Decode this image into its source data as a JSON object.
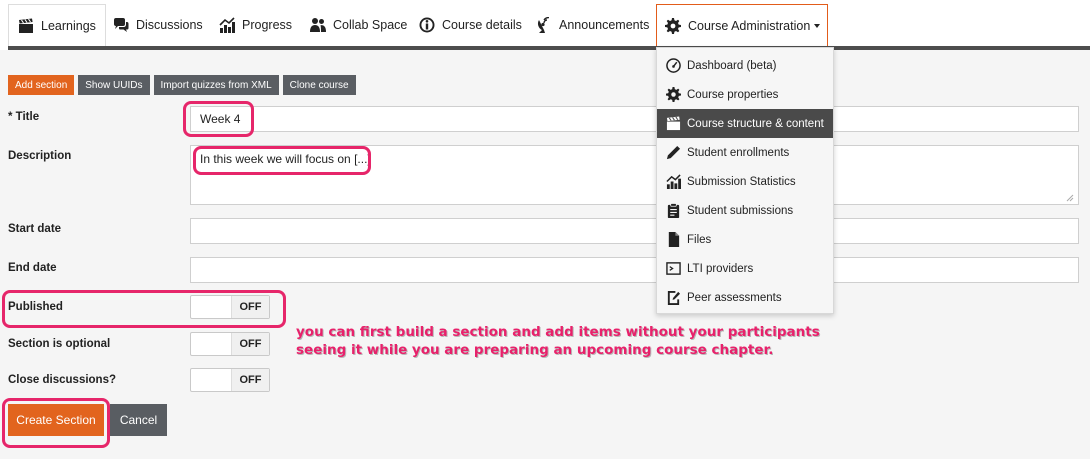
{
  "tabs": [
    {
      "label": "Learnings",
      "icon": "clapperboard-icon"
    },
    {
      "label": "Discussions",
      "icon": "speech-bubbles-icon"
    },
    {
      "label": "Progress",
      "icon": "bar-chart-icon"
    },
    {
      "label": "Collab Space",
      "icon": "users-icon"
    },
    {
      "label": "Course details",
      "icon": "info-icon"
    },
    {
      "label": "Announcements",
      "icon": "broadcast-icon"
    },
    {
      "label": "Course Administration",
      "icon": "gear-icon"
    }
  ],
  "toolbar": {
    "add_section": "Add section",
    "show_uuids": "Show UUIDs",
    "import_quizzes": "Import quizzes from XML",
    "clone_course": "Clone course"
  },
  "form": {
    "title_label": "* Title",
    "title_value": "Week 4",
    "description_label": "Description",
    "description_value": "In this week we will focus on [...]",
    "start_date_label": "Start date",
    "start_date_value": "",
    "end_date_label": "End date",
    "end_date_value": "",
    "published_label": "Published",
    "published_state": "OFF",
    "optional_label": "Section is optional",
    "optional_state": "OFF",
    "close_discussions_label": "Close discussions?",
    "close_discussions_state": "OFF",
    "create_button": "Create Section",
    "cancel_button": "Cancel"
  },
  "admin_menu": [
    {
      "label": "Dashboard (beta)",
      "icon": "dashboard-gauge-icon"
    },
    {
      "label": "Course properties",
      "icon": "gear-icon"
    },
    {
      "label": "Course structure & content",
      "icon": "clapperboard-icon",
      "selected": true
    },
    {
      "label": "Student enrollments",
      "icon": "pencil-icon"
    },
    {
      "label": "Submission Statistics",
      "icon": "bar-chart-icon"
    },
    {
      "label": "Student submissions",
      "icon": "clipboard-icon"
    },
    {
      "label": "Files",
      "icon": "file-icon"
    },
    {
      "label": "LTI providers",
      "icon": "terminal-icon"
    },
    {
      "label": "Peer assessments",
      "icon": "edit-document-icon"
    }
  ],
  "annotation": {
    "line1": "you can first build a section and add items without your participants",
    "line2": "seeing it while you are preparing an upcoming course chapter."
  },
  "colors": {
    "accent_orange": "#e2641e",
    "dark_gray": "#5a5e63",
    "annotation_pink": "#e8216b"
  }
}
